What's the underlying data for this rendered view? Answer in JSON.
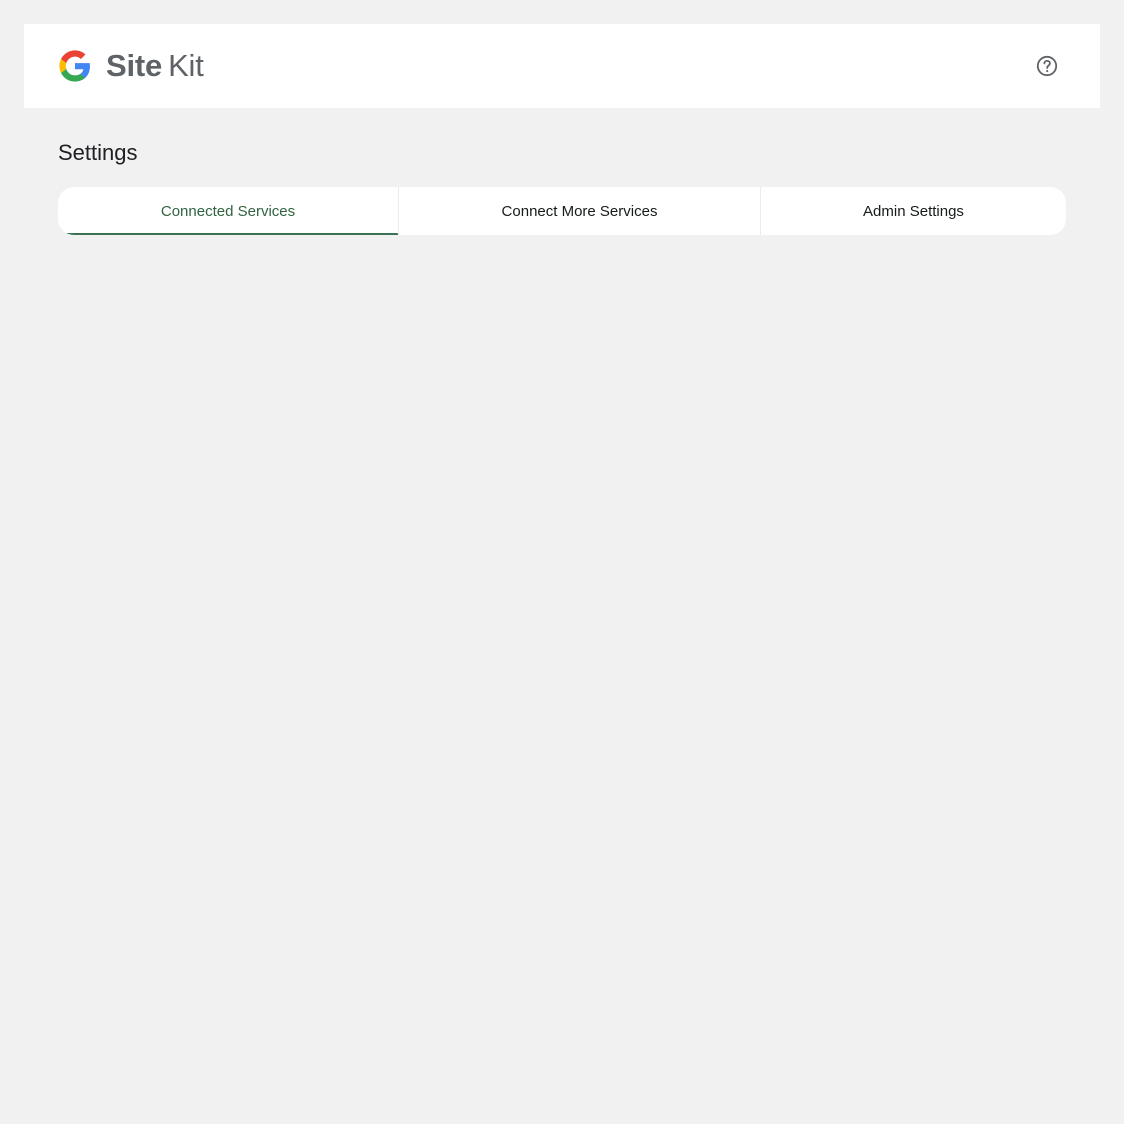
{
  "app": {
    "logo_site": "Site",
    "logo_kit": "Kit",
    "logo_icon": "google-g-icon",
    "help_icon": "help-circle-icon"
  },
  "page": {
    "title": "Settings"
  },
  "tabs": [
    {
      "label": "Connected Services",
      "active": true
    },
    {
      "label": "Connect More Services",
      "active": false
    },
    {
      "label": "Admin Settings",
      "active": false
    }
  ],
  "colors": {
    "background": "#f1f1f1",
    "surface": "#ffffff",
    "active_tab_text": "#30643e",
    "active_tab_indicator": "#3c7251",
    "text_primary": "#202124",
    "logo_text": "#5f6368"
  }
}
